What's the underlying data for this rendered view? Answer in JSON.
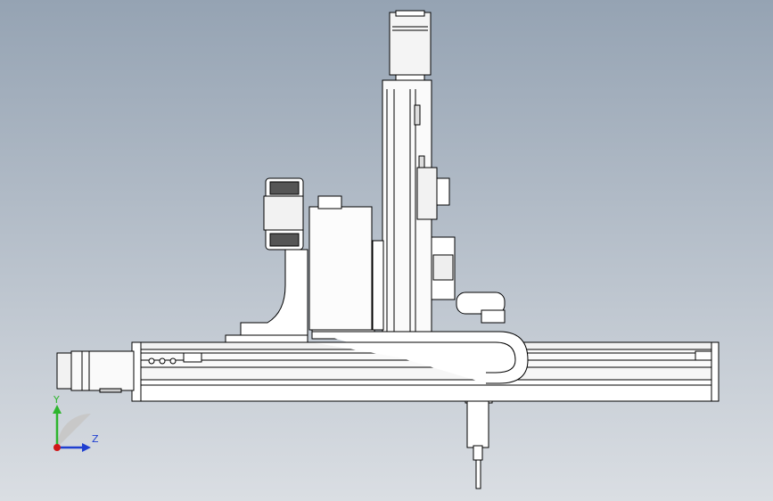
{
  "viewport": {
    "background_top": "#95a3b3",
    "background_bottom": "#dadee3"
  },
  "triad": {
    "y_label": "Y",
    "z_label": "Z",
    "y_color": "#2db52d",
    "z_color": "#1f3fd0",
    "x_color": "#d01818"
  },
  "model": {
    "stroke": "#000000",
    "fill": "#ffffff",
    "shade": "#e6e6e6"
  }
}
